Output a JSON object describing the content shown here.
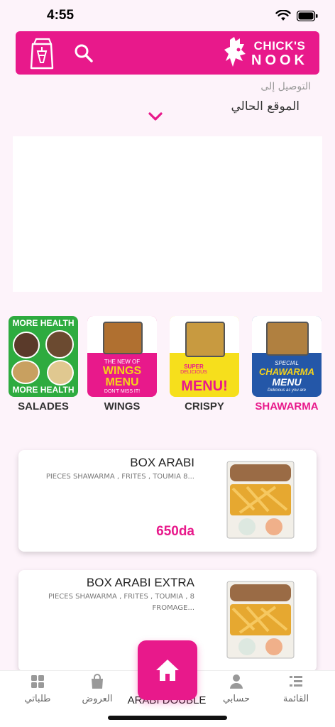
{
  "status": {
    "time": "4:55"
  },
  "header": {
    "logo_line1": "CHICK'S",
    "logo_line2": "NOOK"
  },
  "delivery": {
    "label": "التوصيل إلى",
    "location": "الموقع الحالي"
  },
  "categories": [
    {
      "label": "SALADES",
      "active": false
    },
    {
      "label": "WINGS",
      "active": false
    },
    {
      "label": "CRISPY",
      "active": false
    },
    {
      "label": "SHAWARMA",
      "active": true
    }
  ],
  "category_art": {
    "salades": {
      "top": "MORE HEALTH",
      "bottom": "MORE HEALTH"
    },
    "wings": {
      "line1": "THE NEW OF",
      "line2": "WINGS",
      "line3": "MENU",
      "line4": "DON'T MISS IT!"
    },
    "crispy": {
      "line1": "SUPER",
      "line2": "DELICIOUS",
      "line3": "MENU!"
    },
    "shawarma": {
      "line1": "SPECIAL",
      "line2": "CHAWARMA",
      "line3": "MENU",
      "line4": "Delicious as you are"
    }
  },
  "products": [
    {
      "title": "BOX ARABI",
      "description": "PIECES SHAWARMA , FRITES , TOUMIA 8...",
      "price": "650da"
    },
    {
      "title": "BOX ARABI EXTRA",
      "description": "PIECES SHAWARMA , FRITES , TOUMIA , 8 FROMAGE...",
      "price": ""
    }
  ],
  "peek_text": "ARABI DOUBLE",
  "tabs": [
    {
      "label": "طلباتي",
      "icon": "grid-icon"
    },
    {
      "label": "العروض",
      "icon": "bag-icon"
    },
    {
      "label": "حسابي",
      "icon": "person-icon"
    },
    {
      "label": "القائمة",
      "icon": "list-icon"
    }
  ],
  "colors": {
    "brand": "#e8198b",
    "background": "#fdf3fa"
  }
}
